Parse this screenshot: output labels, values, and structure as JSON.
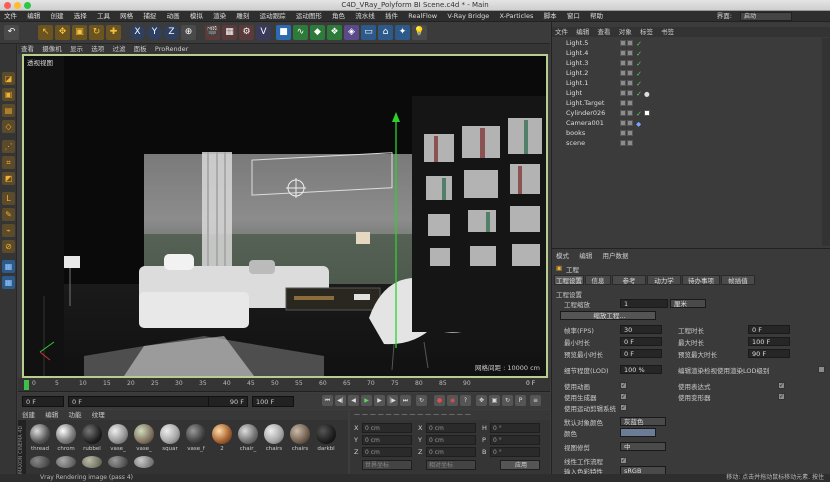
{
  "window": {
    "title": "C4D_VRay_Polyform BI Scene.c4d * - Main"
  },
  "menubar": {
    "items": [
      "文件",
      "编辑",
      "创建",
      "选择",
      "工具",
      "网格",
      "捕捉",
      "动画",
      "模拟",
      "渲染",
      "雕刻",
      "运动跟踪",
      "运动图形",
      "角色",
      "流水线",
      "插件",
      "RealFlow",
      "V-Ray Bridge",
      "X-Particles",
      "脚本",
      "窗口",
      "帮助"
    ],
    "layout_label": "界面:",
    "layout_value": "启动"
  },
  "toolbar": {
    "xyz": [
      "X",
      "Y",
      "Z"
    ]
  },
  "viewport": {
    "menu": [
      "查看",
      "摄像机",
      "显示",
      "选项",
      "过滤",
      "面板",
      "ProRender"
    ],
    "title": "透视视图",
    "grid_info": "网格间距 : 10000 cm"
  },
  "timeline": {
    "ticks": [
      "0",
      "5",
      "10",
      "15",
      "20",
      "25",
      "30",
      "35",
      "40",
      "45",
      "50",
      "55",
      "60",
      "65",
      "70",
      "75",
      "80",
      "85",
      "90"
    ],
    "end": "0 F"
  },
  "transport": {
    "start": "0 F",
    "current": "0 F",
    "end": "90 F",
    "end2": "100 F"
  },
  "materials": {
    "menu": [
      "创建",
      "编辑",
      "功能",
      "纹理"
    ],
    "items": [
      "thread",
      "chrom",
      "rubbel",
      "vase_",
      "vase_",
      "squar",
      "vase_f",
      "2",
      "chair_",
      "chairs",
      "chairs",
      "darkbl"
    ],
    "logo": "MAXON CINEMA 4D"
  },
  "coords": {
    "rows": [
      {
        "axis": "X",
        "v1": "0 cm",
        "axis2": "X",
        "v2": "0 cm",
        "axis3": "H",
        "v3": "0 °"
      },
      {
        "axis": "Y",
        "v1": "0 cm",
        "axis2": "Y",
        "v2": "0 cm",
        "axis3": "P",
        "v3": "0 °"
      },
      {
        "axis": "Z",
        "v1": "0 cm",
        "axis2": "Z",
        "v2": "0 cm",
        "axis3": "B",
        "v3": "0 °"
      }
    ],
    "mode1": "世界坐标",
    "mode2": "相对坐标",
    "apply": "应用"
  },
  "objects": {
    "menu": [
      "文件",
      "编辑",
      "查看",
      "对象",
      "标签",
      "书签"
    ],
    "items": [
      "Light.5",
      "Light.4",
      "Light.3",
      "Light.2",
      "Light.1",
      "Light",
      "Light.Target",
      "Cylinder026",
      "Camera001",
      "books",
      "scene"
    ]
  },
  "attributes": {
    "menu": [
      "模式",
      "编辑",
      "用户数据"
    ],
    "header": "工程",
    "tabs": [
      "工程设置",
      "信息",
      "参考",
      "动力学",
      "待办事项",
      "帧插值"
    ],
    "section": "工程设置",
    "scale_label": "工程缩放",
    "scale_value": "1",
    "scale_unit": "厘米",
    "scale_button": "缩放工程...",
    "fps_label": "帧率(FPS)",
    "fps_value": "30",
    "duration_label": "工程时长",
    "duration_value": "0 F",
    "min_label": "最小时长",
    "min_value": "0 F",
    "max_label": "最大时长",
    "max_value": "100 F",
    "pmin_label": "预览最小时长",
    "pmin_value": "0 F",
    "pmax_label": "预览最大时长",
    "pmax_value": "90 F",
    "lod_label": "细节程度(LOD)",
    "lod_value": "100 %",
    "lod_check_label": "编辑渲染检视使用渲染LOD级别",
    "anim_label": "使用动画",
    "expr_label": "使用表达式",
    "gen_label": "使用生成器",
    "deform_label": "使用变形器",
    "mo_label": "使用运动剪辑系统",
    "objcolor_label": "默认对象颜色",
    "objcolor_value": "灰蓝色",
    "color_label": "颜色",
    "view_label": "视图修剪",
    "view_value": "中",
    "linear_label": "线性工作流程",
    "input_label": "输入色彩特性",
    "input_value": "sRGB"
  },
  "status": {
    "left": "Vray Rendering image (pass 4)",
    "right": "移动: 点击并拖动鼠标移动元素. 按住"
  }
}
